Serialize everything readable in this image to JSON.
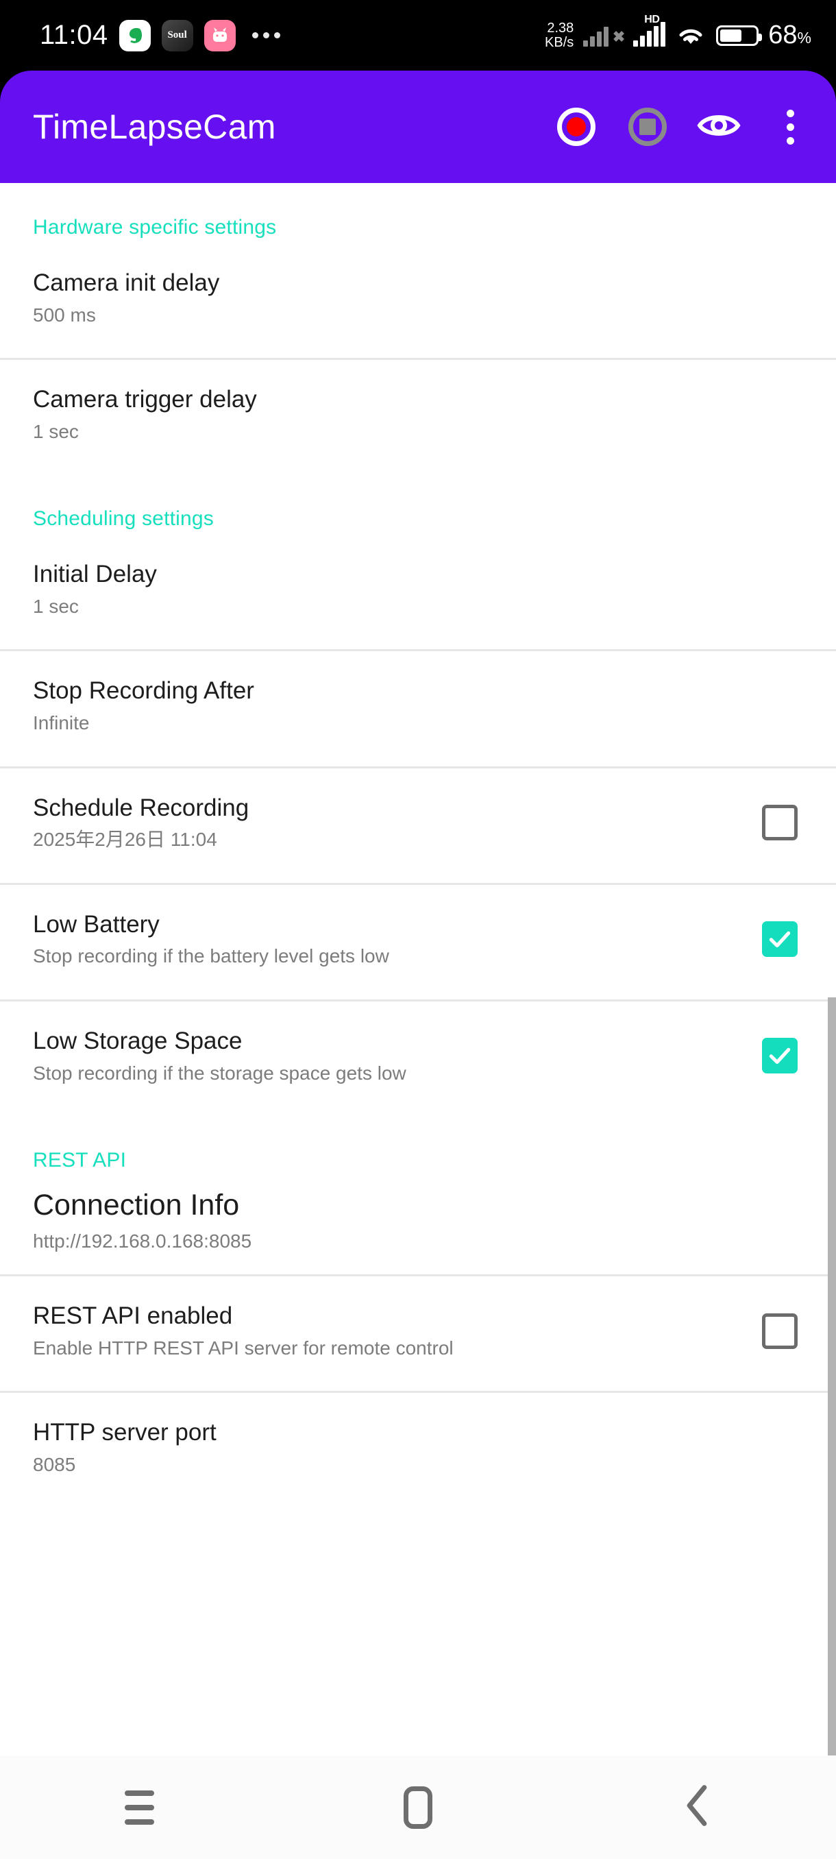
{
  "status_bar": {
    "clock": "11:04",
    "app_icons": [
      {
        "name": "wechat-icon",
        "glyph": "◔"
      },
      {
        "name": "soul-app-icon",
        "glyph": "Soul"
      },
      {
        "name": "pink-app-icon",
        "glyph": "◎"
      }
    ],
    "overflow_glyph": "•••",
    "net_speed_value": "2.38",
    "net_speed_unit": "KB/s",
    "hd_label": "HD",
    "battery_percent": "68",
    "battery_percent_symbol": "%"
  },
  "app_bar": {
    "title": "TimeLapseCam",
    "record_label": "record-button",
    "stop_label": "stop-button",
    "preview_label": "preview-eye-button",
    "overflow_label": "overflow-menu-button",
    "background_color": "#6610f2",
    "record_dot_color": "#ff0000",
    "stop_disabled_color": "#8a8a8a"
  },
  "theme": {
    "accent_teal": "#16dfbd",
    "checkbox_on": "#14ddbe",
    "checkbox_off_border": "#6b6b6b",
    "divider": "#e6e6e6",
    "title_text": "#1d1d1d",
    "subtitle_text": "#7c7c7c"
  },
  "sections": [
    {
      "header": "Hardware specific settings",
      "rows": [
        {
          "title": "Camera init delay",
          "subtitle": "500 ms",
          "control": "none",
          "name": "camera-init-delay"
        },
        {
          "title": "Camera trigger delay",
          "subtitle": "1 sec",
          "control": "none",
          "name": "camera-trigger-delay"
        }
      ]
    },
    {
      "header": "Scheduling settings",
      "rows": [
        {
          "title": "Initial Delay",
          "subtitle": "1 sec",
          "control": "none",
          "name": "initial-delay"
        },
        {
          "title": "Stop Recording After",
          "subtitle": "Infinite",
          "control": "none",
          "name": "stop-recording-after"
        },
        {
          "title": "Schedule Recording",
          "subtitle": "2025年2月26日 11:04",
          "control": "checkbox",
          "checked": false,
          "name": "schedule-recording"
        },
        {
          "title": "Low Battery",
          "subtitle": "Stop recording if the battery level gets low",
          "control": "checkbox",
          "checked": true,
          "name": "low-battery"
        },
        {
          "title": "Low Storage Space",
          "subtitle": "Stop recording if the storage space gets low",
          "control": "checkbox",
          "checked": true,
          "name": "low-storage-space"
        }
      ]
    },
    {
      "header": "REST API",
      "rows": [
        {
          "title": "Connection Info",
          "subtitle": "http://192.168.0.168:8085",
          "control": "none",
          "big": true,
          "name": "connection-info"
        },
        {
          "title": "REST API enabled",
          "subtitle": "Enable HTTP REST API server for remote control",
          "control": "checkbox",
          "checked": false,
          "name": "rest-api-enabled"
        },
        {
          "title": "HTTP server port",
          "subtitle": "8085",
          "control": "none",
          "name": "http-server-port"
        }
      ]
    }
  ],
  "nav_bar": {
    "recents_label": "recents-button",
    "home_label": "home-button",
    "back_label": "back-button"
  }
}
